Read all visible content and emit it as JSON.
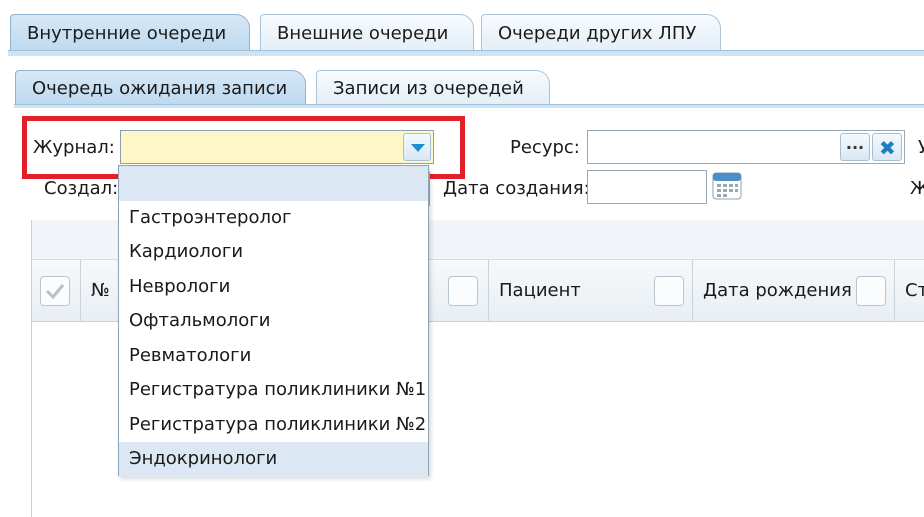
{
  "tabs_top": [
    {
      "label": "Внутренние очереди",
      "active": true
    },
    {
      "label": "Внешние очереди",
      "active": false
    },
    {
      "label": "Очереди других ЛПУ",
      "active": false
    }
  ],
  "tabs_sub": [
    {
      "label": "Очередь ожидания записи",
      "active": true
    },
    {
      "label": "Записи из очередей",
      "active": false
    }
  ],
  "form": {
    "journal_label": "Журнал:",
    "journal_value": "",
    "resource_label": "Ресурс:",
    "resource_value": "",
    "browse_label": "...",
    "created_by_label": "Создал:",
    "created_date_label": "Дата создания:",
    "created_date_value": "",
    "cut_label_1": "У",
    "cut_label_2": "Ж"
  },
  "grid": {
    "columns": [
      "№",
      "Пациент",
      "Дата рождения",
      "Ст"
    ]
  },
  "dropdown": {
    "items": [
      "",
      "Гастроэнтеролог",
      "Кардиологи",
      "Неврологи",
      "Офтальмологи",
      "Ревматологи",
      "Регистратура поликлиники №1",
      "Регистратура поликлиники №2",
      "Эндокринологи"
    ],
    "selected_index": 0,
    "hover_index": 8
  },
  "colors": {
    "highlight": "#e2202a",
    "field_active": "#fdf6c6",
    "tab_active": "#bcd8ef",
    "selected_row": "#dbe8f3"
  },
  "icons": [
    "chevron-down-icon",
    "browse-icon",
    "clear-icon",
    "calendar-icon",
    "checkbox-icon"
  ]
}
